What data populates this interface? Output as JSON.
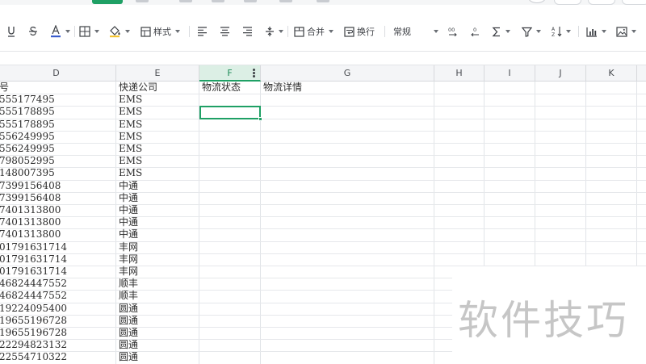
{
  "toolbar": {
    "style_label": "样式",
    "merge_label": "合并",
    "wrap_label": "换行",
    "number_format": "常规",
    "accent_color": "#1fa065",
    "font_color": "#3a5ccc",
    "fill_color": "#f4c430"
  },
  "columns": [
    {
      "id": "D",
      "label": "D"
    },
    {
      "id": "E",
      "label": "E"
    },
    {
      "id": "F",
      "label": "F",
      "selected": true
    },
    {
      "id": "G",
      "label": "G"
    },
    {
      "id": "H",
      "label": "H"
    },
    {
      "id": "I",
      "label": "I"
    },
    {
      "id": "J",
      "label": "J"
    },
    {
      "id": "K",
      "label": "K"
    }
  ],
  "header_row": {
    "D": "号",
    "E": "快递公司",
    "F": "物流状态",
    "G": "物流详情"
  },
  "rows": [
    {
      "D": "555177495",
      "E": "EMS"
    },
    {
      "D": "555178895",
      "E": "EMS"
    },
    {
      "D": "555178895",
      "E": "EMS"
    },
    {
      "D": "556249995",
      "E": "EMS"
    },
    {
      "D": "556249995",
      "E": "EMS"
    },
    {
      "D": "798052995",
      "E": "EMS"
    },
    {
      "D": "148007395",
      "E": "EMS"
    },
    {
      "D": "7399156408",
      "E": "中通"
    },
    {
      "D": "7399156408",
      "E": "中通"
    },
    {
      "D": "7401313800",
      "E": "中通"
    },
    {
      "D": "7401313800",
      "E": "中通"
    },
    {
      "D": "7401313800",
      "E": "中通"
    },
    {
      "D": "01791631714",
      "E": "丰网"
    },
    {
      "D": "01791631714",
      "E": "丰网"
    },
    {
      "D": "01791631714",
      "E": "丰网"
    },
    {
      "D": "46824447552",
      "E": "顺丰"
    },
    {
      "D": "46824447552",
      "E": "顺丰"
    },
    {
      "D": "19224095400",
      "E": "圆通"
    },
    {
      "D": "19655196728",
      "E": "圆通"
    },
    {
      "D": "19655196728",
      "E": "圆通"
    },
    {
      "D": "22294823132",
      "E": "圆通"
    },
    {
      "D": "22554710322",
      "E": "圆通"
    }
  ],
  "active_cell": "F3",
  "watermark_text": "软件技巧",
  "icons": {
    "underline": "underline-icon",
    "strikethrough": "strikethrough-icon",
    "font_color": "font-color-icon",
    "border": "border-icon",
    "fill": "fill-color-icon",
    "style": "table-style-icon",
    "align_left": "align-left-icon",
    "align_center": "align-center-icon",
    "align_right": "align-right-icon",
    "vertical_align": "vertical-align-icon",
    "merge": "merge-cells-icon",
    "wrap": "wrap-text-icon",
    "decimal_increase": "increase-decimal-icon",
    "decimal_decrease": "decrease-decimal-icon",
    "sum": "sum-icon",
    "filter": "filter-icon",
    "sort": "sort-icon",
    "chart": "chart-icon",
    "image": "image-icon"
  }
}
